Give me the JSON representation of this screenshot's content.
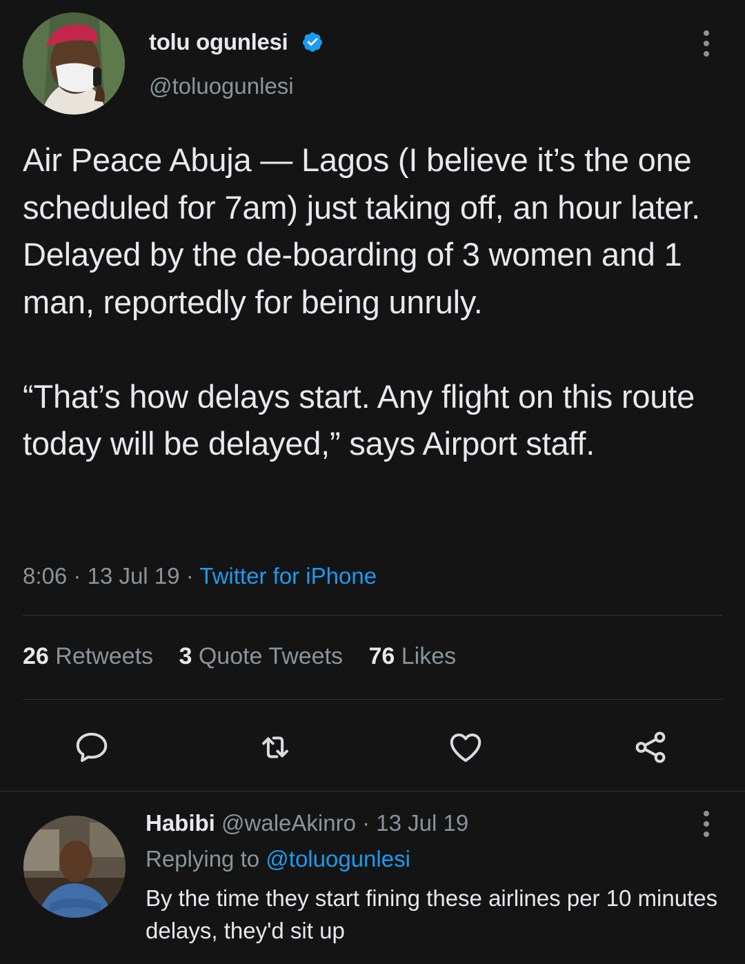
{
  "main_tweet": {
    "author_name": "tolu ogunlesi",
    "handle": "@toluogunlesi",
    "verified": true,
    "text": "Air Peace Abuja — Lagos (I believe it’s the one scheduled for 7am) just taking off, an hour later. Delayed by the de-boarding of 3 women and 1 man, reportedly for being unruly.\n\n“That’s how delays start. Any flight on this route today will be delayed,” says Airport staff.",
    "time": "8:06",
    "date": "13 Jul 19",
    "separator": "·",
    "source": "Twitter for iPhone",
    "stats": {
      "retweets_count": "26",
      "retweets_label": "Retweets",
      "quotes_count": "3",
      "quotes_label": "Quote Tweets",
      "likes_count": "76",
      "likes_label": "Likes"
    }
  },
  "reply": {
    "author_name": "Habibi",
    "handle": "@waleAkinro",
    "separator": "·",
    "date": "13 Jul 19",
    "replying_to_label": "Replying to",
    "replying_to_handle": "@toluogunlesi",
    "text": "By the time they start fining these airlines per 10 minutes delays, they'd sit up"
  },
  "colors": {
    "background": "#141414",
    "text": "#e7e9ea",
    "secondary": "#8b949b",
    "accent": "#1d9bf0"
  },
  "icons": {
    "verified": "verified-badge-icon",
    "more": "more-vertical-icon",
    "reply": "reply-bubble-icon",
    "retweet": "retweet-icon",
    "like": "heart-icon",
    "share": "share-icon"
  }
}
